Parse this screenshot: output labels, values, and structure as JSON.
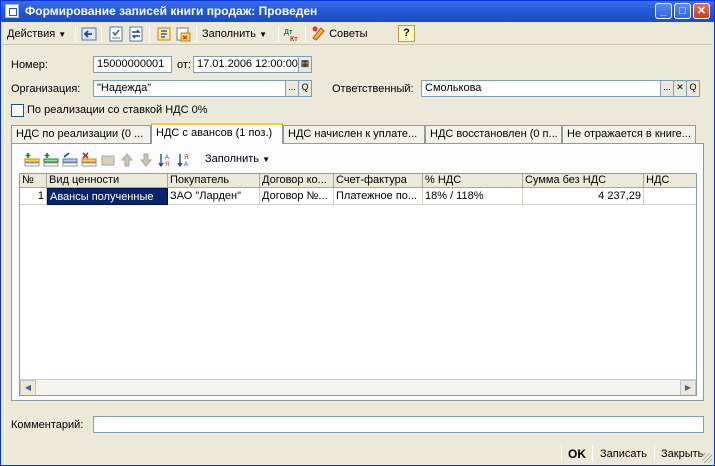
{
  "window": {
    "title": "Формирование записей книги продаж: Проведен",
    "controls": {
      "minimize": "_",
      "maximize": "□",
      "close": "✕"
    }
  },
  "toolbar": {
    "actions_label": "Действия",
    "fill_label": "Заполнить",
    "advice_label": "Советы",
    "help_label": "?"
  },
  "header": {
    "number_label": "Номер:",
    "number_value": "15000000001",
    "date_label": "от:",
    "date_value": "17.01.2006 12:00:00",
    "org_label": "Организация:",
    "org_value": "\"Надежда\"",
    "responsible_label": "Ответственный:",
    "responsible_value": "Смолькова",
    "vat0_label": "По реализации со ставкой НДС 0%",
    "select_btn": "...",
    "open_btn": "Q",
    "clear_btn": "✕"
  },
  "tabs": [
    "НДС по реализации (0 ...",
    "НДС с авансов (1 поз.)",
    "НДС начислен к уплате...",
    "НДС восстановлен (0 п...",
    "Не отражается в книге..."
  ],
  "table": {
    "fill_label": "Заполнить",
    "columns": [
      "№",
      "Вид ценности",
      "Покупатель",
      "Договор ко...",
      "Счет-фактура",
      "% НДС",
      "Сумма без НДС",
      "НДС"
    ],
    "rows": [
      [
        "1",
        "Авансы полученные",
        "ЗАО \"Ларден\"",
        "Договор №...",
        "Платежное по...",
        "18% / 118%",
        "4 237,29",
        ""
      ]
    ]
  },
  "comment": {
    "label": "Комментарий:",
    "value": ""
  },
  "buttons": {
    "ok": "OK",
    "save": "Записать",
    "close": "Закрыть"
  }
}
